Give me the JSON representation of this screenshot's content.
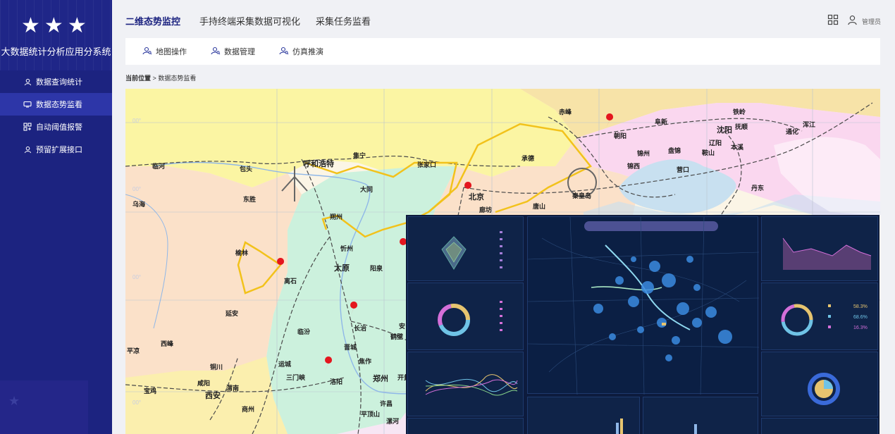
{
  "app": {
    "title": "大数据统计分析应用分系统"
  },
  "sidebar": {
    "items": [
      {
        "label": "数据查询统计"
      },
      {
        "label": "数据态势监看"
      },
      {
        "label": "自动阈值报警"
      },
      {
        "label": "预留扩展接口"
      }
    ]
  },
  "topnav": {
    "tabs": [
      {
        "label": "二维态势监控"
      },
      {
        "label": "手持终端采集数据可视化"
      },
      {
        "label": "采集任务监看"
      }
    ],
    "user": "管理员"
  },
  "toolbar": {
    "items": [
      {
        "label": "地图操作"
      },
      {
        "label": "数据管理"
      },
      {
        "label": "仿真推演"
      }
    ]
  },
  "breadcrumb": {
    "prefix": "当前位置",
    "separator": ">",
    "current": "数据态势监看"
  },
  "map": {
    "cities": {
      "huhehaote": "呼和浩特",
      "jining": "集宁",
      "zhangjiakou": "张家口",
      "beijing": "北京",
      "langfang": "廊坊",
      "tangshan": "唐山",
      "qinhuangdao": "秦皇岛",
      "chengde": "承德",
      "chifeng": "赤峰",
      "chaoyang": "朝阳",
      "fuxin": "阜新",
      "shenyang": "沈阳",
      "tieling": "铁岭",
      "fushun": "抚顺",
      "liaoyang": "辽阳",
      "benxi": "本溪",
      "anshan": "鞍山",
      "panjin": "盘锦",
      "jinzhou": "锦州",
      "jinxi": "锦西",
      "yingkou": "营口",
      "dandong": "丹东",
      "tonghua": "通化",
      "hunjiang": "浑江",
      "linhe": "临河",
      "baotou": "包头",
      "dongsheng": "东胜",
      "wuhai": "乌海",
      "datong": "大同",
      "shuozhou": "朔州",
      "xinzhou": "忻州",
      "yulin": "榆林",
      "lishi": "离石",
      "taiyuan": "太原",
      "yangquan": "阳泉",
      "yanan": "延安",
      "linfen": "临汾",
      "changzhi": "长治",
      "jincheng": "晋城",
      "xifeng": "西峰",
      "tongchuan": "铜川",
      "yuncheng": "运城",
      "sanmenxia": "三门峡",
      "luoyang": "洛阳",
      "zhengzhou": "郑州",
      "jiaozuo": "焦作",
      "kaifeng": "开封",
      "xuchang": "许昌",
      "pingdingshan": "平顶山",
      "luohe": "漯河",
      "xianyang": "咸阳",
      "weinan": "渭南",
      "xian": "西安",
      "shangzhou": "商州",
      "baoji": "宝鸡",
      "pingliang": "平凉",
      "hebi": "鹤壁",
      "anyang": "安"
    }
  },
  "dashboard": {
    "values": {
      "p1": "58.3%",
      "p2": "68.6%",
      "p3": "16.3%"
    }
  },
  "colors": {
    "sidebar_bg": "#1c2380",
    "sidebar_active": "#2d36a8",
    "accent": "#1c2380",
    "route_line": "#f2c21b",
    "marker": "#e4161e"
  },
  "icons": {
    "grid": "grid-icon",
    "user": "user-icon",
    "map-search": "map-search-icon"
  }
}
